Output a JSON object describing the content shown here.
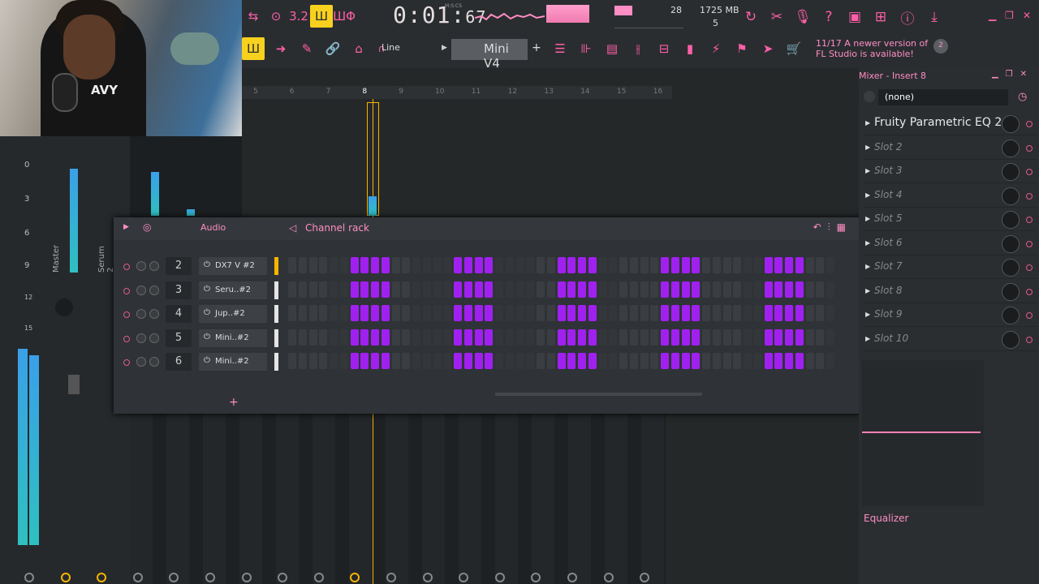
{
  "toolbar": {
    "time": "0:01",
    "time_frac": "67",
    "time_unit": "M:S:CS",
    "pattern_mode": "Line",
    "pattern_name": "Mini V4",
    "plus": "+",
    "stats": {
      "voices": "28",
      "memory": "1725 MB",
      "cpu_poly": "5"
    },
    "notice_line1": "11/17  A newer version of",
    "notice_line2": "FL Studio is available!",
    "notice_badge": "2",
    "accent": "#ff5fa8"
  },
  "webcam": {
    "shirt_text": "AVY"
  },
  "playlist": {
    "ruler": [
      "5",
      "6",
      "7",
      "8",
      "9",
      "10",
      "11",
      "12",
      "13",
      "14",
      "15",
      "16"
    ]
  },
  "left_mixer": {
    "db_ticks": [
      "0",
      "3",
      "6",
      "9",
      "12",
      "15"
    ],
    "master_label": "Master",
    "serum_label": "Serum 2"
  },
  "channel_rack": {
    "title": "Channel rack",
    "filter": "Audio",
    "channels": [
      {
        "num": "2",
        "name": "DX7 V #2",
        "selected": true
      },
      {
        "num": "3",
        "name": "Seru..#2",
        "selected": false
      },
      {
        "num": "4",
        "name": "Jup..#2",
        "selected": false
      },
      {
        "num": "5",
        "name": "Mini..#2",
        "selected": false
      },
      {
        "num": "6",
        "name": "Mini..#2",
        "selected": false
      }
    ],
    "step_count": 53,
    "step_on_color": "#a020f0",
    "add_label": "+"
  },
  "mixer": {
    "title": "Mixer - Insert 8",
    "input": "(none)",
    "slots": [
      {
        "label": "Fruity Parametric EQ 2",
        "active": true
      },
      {
        "label": "Slot 2",
        "active": false
      },
      {
        "label": "Slot 3",
        "active": false
      },
      {
        "label": "Slot 4",
        "active": false
      },
      {
        "label": "Slot 5",
        "active": false
      },
      {
        "label": "Slot 6",
        "active": false
      },
      {
        "label": "Slot 7",
        "active": false
      },
      {
        "label": "Slot 8",
        "active": false
      },
      {
        "label": "Slot 9",
        "active": false
      },
      {
        "label": "Slot 10",
        "active": false
      }
    ],
    "equalizer_label": "Equalizer"
  }
}
